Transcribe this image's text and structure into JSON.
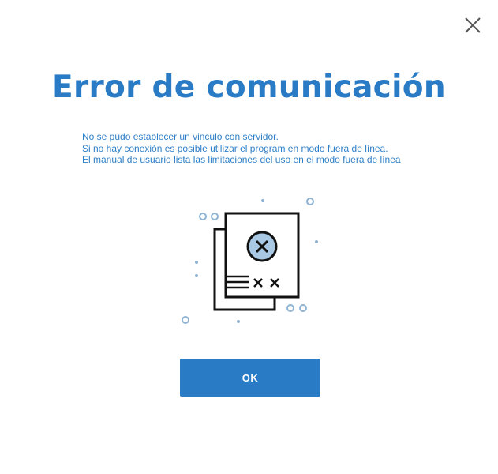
{
  "dialog": {
    "title": "Error de comunicación",
    "message_lines": [
      "No se pudo establecer un vinculo con servidor.",
      "Si no hay conexión es posible utilizar el program en modo fuera de línea.",
      "El manual de usuario lista las limitaciones del uso en el modo fuera de línea"
    ],
    "ok_label": "OK",
    "close_icon": "close-icon",
    "illustration_icon": "document-error-icon"
  },
  "colors": {
    "accent": "#2a7bc6",
    "text": "#2f80c8",
    "illustration_fill": "#a9c8e3",
    "illustration_dots": "#8fb3d4",
    "close_icon": "#555555"
  }
}
